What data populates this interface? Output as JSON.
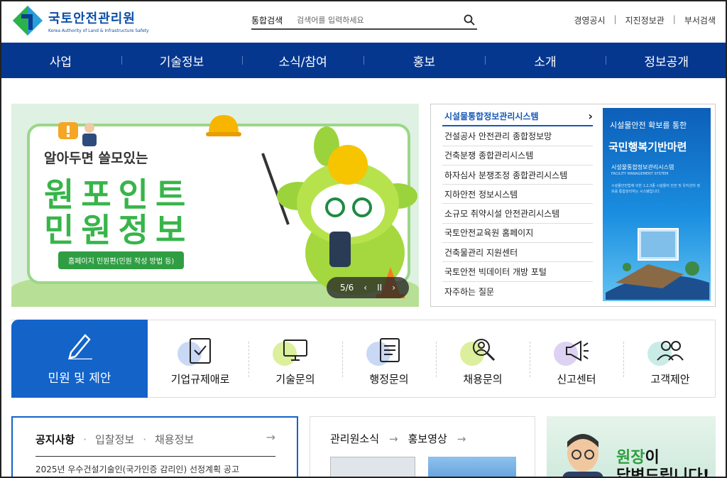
{
  "header": {
    "logo_name": "국토안전관리원",
    "logo_sub": "Korea Authority of Land & Infrastructure Safety",
    "search_label": "통합검색",
    "search_placeholder": "검색어를 입력하세요",
    "utility_links": [
      "경영공시",
      "지진정보관",
      "부서검색"
    ]
  },
  "nav": [
    "사업",
    "기술정보",
    "소식/참여",
    "홍보",
    "소개",
    "정보공개"
  ],
  "banner": {
    "pre": "알아두면 쓸모있는",
    "title1": "원포인트",
    "title2": "민원정보",
    "pill": "홈페이지 민원편(민원 작성 방법 등)",
    "counter": "5/6",
    "prev": "‹",
    "pause": "II",
    "next": "›"
  },
  "systems": {
    "items": [
      "시설물통합정보관리시스템",
      "건설공사 안전관리 종합정보망",
      "건축분쟁 종합관리시스템",
      "하자심사 분쟁조정 종합관리시스템",
      "지하안전 정보시스템",
      "소규모 취약시설 안전관리시스템",
      "국토안전교육원 홈페이지",
      "건축물관리 지원센터",
      "국토안전 빅데이터 개방 포털",
      "자주하는 질문"
    ],
    "active_arrow": "›",
    "ad": {
      "line1": "시설물안전 확보를 통한",
      "line2": "국민행복기반마련",
      "line3": "시설물통합정보관리시스템",
      "line4": "FACILITY MANAGEMENT SYSTEM",
      "desc": "시설물안전법에 의한 1,2,3종 시설물의 안전 및 유지관리 정보를 통합관리하는 시스템입니다."
    }
  },
  "quick": {
    "main": "민원 및 제안",
    "items": [
      "기업규제애로",
      "기술문의",
      "행정문의",
      "채용문의",
      "신고센터",
      "고객제안"
    ]
  },
  "notice": {
    "tabs": [
      "공지사항",
      "입찰정보",
      "채용정보"
    ],
    "arrow": "→",
    "first_item": "2025년 우수건설기술인(국가인증 감리인) 선정계획 공고"
  },
  "news": {
    "tab1": "관리원소식",
    "tab2": "홍보영상",
    "arrow": "→"
  },
  "director": {
    "t1_green": "원장",
    "t1_rest": "이",
    "t2": "답변드립니다!"
  },
  "colors": {
    "nav_bg": "#06378f",
    "brand_blue": "#1363c9",
    "banner_green": "#37b54a"
  }
}
